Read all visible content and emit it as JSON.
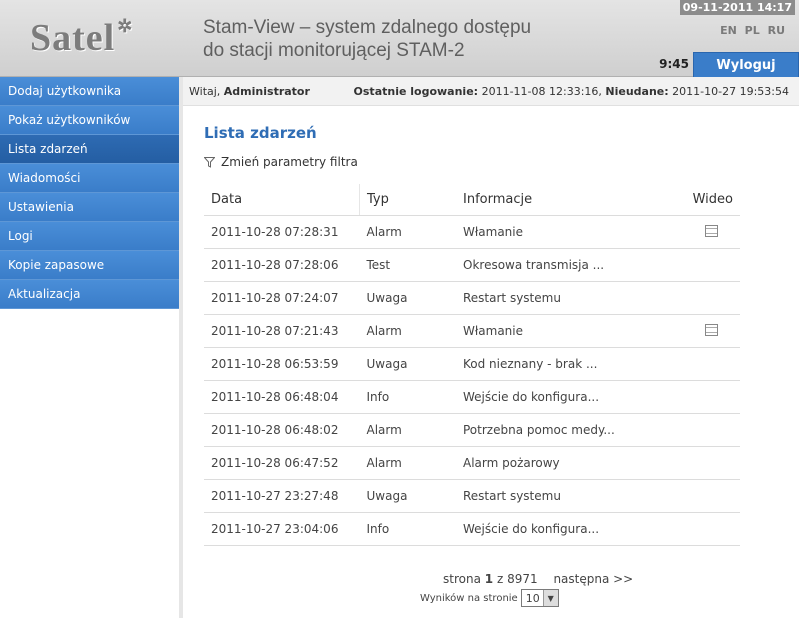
{
  "header": {
    "logo_text": "Satel",
    "title_line1": "Stam-View – system zdalnego dostępu",
    "title_line2": "do stacji monitorującej STAM-2",
    "datetime": "09-11-2011 14:17",
    "languages": [
      "EN",
      "PL",
      "RU"
    ],
    "clock": "9:45",
    "logout_label": "Wyloguj"
  },
  "sidebar": {
    "items": [
      {
        "label": "Dodaj użytkownika"
      },
      {
        "label": "Pokaż użytkowników"
      },
      {
        "label": "Lista zdarzeń"
      },
      {
        "label": "Wiadomości"
      },
      {
        "label": "Ustawienia"
      },
      {
        "label": "Logi"
      },
      {
        "label": "Kopie zapasowe"
      },
      {
        "label": "Aktualizacja"
      }
    ],
    "active_index": 2
  },
  "infobar": {
    "welcome_prefix": "Witaj, ",
    "user": "Administrator",
    "last_login_label": "Ostatnie logowanie:",
    "last_login_value": "2011-11-08 12:33:16,",
    "failed_label": "Nieudane:",
    "failed_value": "2011-10-27 19:53:54"
  },
  "main": {
    "title": "Lista zdarzeń",
    "filter_label": "Zmień parametry filtra",
    "columns": [
      "Data",
      "Typ",
      "Informacje",
      "Wideo"
    ],
    "rows": [
      {
        "date": "2011-10-28 07:28:31",
        "type": "Alarm",
        "info": "Włamanie",
        "video": true
      },
      {
        "date": "2011-10-28 07:28:06",
        "type": "Test",
        "info": "Okresowa transmisja ...",
        "video": false
      },
      {
        "date": "2011-10-28 07:24:07",
        "type": "Uwaga",
        "info": "Restart systemu",
        "video": false
      },
      {
        "date": "2011-10-28 07:21:43",
        "type": "Alarm",
        "info": "Włamanie",
        "video": true
      },
      {
        "date": "2011-10-28 06:53:59",
        "type": "Uwaga",
        "info": "Kod nieznany - brak ...",
        "video": false
      },
      {
        "date": "2011-10-28 06:48:04",
        "type": "Info",
        "info": "Wejście do konfigura...",
        "video": false
      },
      {
        "date": "2011-10-28 06:48:02",
        "type": "Alarm",
        "info": "Potrzebna pomoc medy...",
        "video": false
      },
      {
        "date": "2011-10-28 06:47:52",
        "type": "Alarm",
        "info": "Alarm pożarowy",
        "video": false
      },
      {
        "date": "2011-10-27 23:27:48",
        "type": "Uwaga",
        "info": "Restart systemu",
        "video": false
      },
      {
        "date": "2011-10-27 23:04:06",
        "type": "Info",
        "info": "Wejście do konfigura...",
        "video": false
      }
    ],
    "pager": {
      "prefix": "strona",
      "current": "1",
      "of": "z 8971",
      "next_label": "następna >>"
    },
    "per_page_label": "Wyników na stronie",
    "per_page_value": "10"
  },
  "colors": {
    "nav_bg": "#3a7dc9",
    "nav_active": "#245ea3",
    "title_blue": "#2f6db5"
  }
}
